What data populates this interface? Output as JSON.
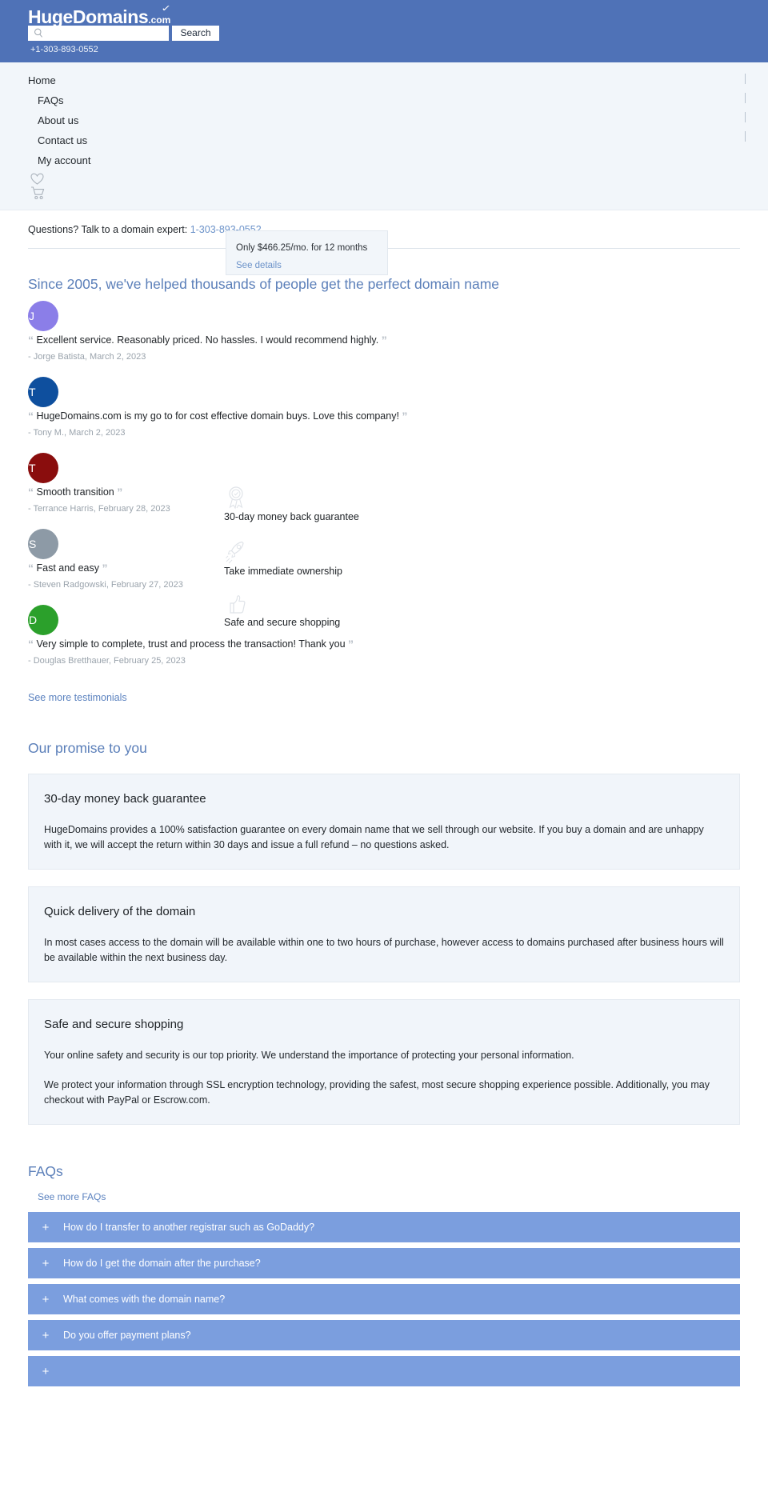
{
  "header": {
    "logo_main": "HugeDomains",
    "logo_suffix": ".com",
    "search_placeholder": "",
    "search_value": "",
    "search_button": "Search",
    "phone": "+1-303-893-0552",
    "brand_color": "#4f72b7"
  },
  "nav": {
    "items": [
      {
        "label": "Home",
        "sub": false
      },
      {
        "label": "FAQs",
        "sub": true
      },
      {
        "label": "About us",
        "sub": true
      },
      {
        "label": "Contact us",
        "sub": true
      },
      {
        "label": "My account",
        "sub": true
      }
    ],
    "icons": [
      {
        "name": "heart-icon"
      },
      {
        "name": "cart-icon"
      }
    ]
  },
  "expert": {
    "prefix": "Questions? Talk to a domain expert:",
    "phone": "1-303-893-0552"
  },
  "price_box": {
    "text": "Only $466.25/mo. for 12 months",
    "link": "See details"
  },
  "testimonials_section": {
    "title": "Since 2005, we've helped thousands of people get the perfect domain name",
    "see_more": "See more testimonials",
    "items": [
      {
        "initial": "J",
        "color": "#8b7ee8",
        "quote": "Excellent service. Reasonably priced. No hassles. I would recommend highly.",
        "author": "- Jorge Batista, March 2, 2023"
      },
      {
        "initial": "T",
        "color": "#0e4f9e",
        "quote": "HugeDomains.com is my go to for cost effective domain buys. Love this company!",
        "author": "- Tony M., March 2, 2023"
      },
      {
        "initial": "T",
        "color": "#8a0d0d",
        "quote": "Smooth transition",
        "author": "- Terrance Harris, February 28, 2023"
      },
      {
        "initial": "S",
        "color": "#8d9aa6",
        "quote": "Fast and easy",
        "author": "- Steven Radgowski, February 27, 2023"
      },
      {
        "initial": "D",
        "color": "#2ba02b",
        "quote": "Very simple to complete, trust and process the transaction! Thank you",
        "author": "- Douglas Bretthauer, February 25, 2023"
      }
    ],
    "quote_open": "“",
    "quote_close": "”"
  },
  "features": [
    {
      "icon": "badge-ribbon-icon",
      "label": "30-day money back guarantee"
    },
    {
      "icon": "rocket-icon",
      "label": "Take immediate ownership"
    },
    {
      "icon": "thumbs-up-icon",
      "label": "Safe and secure shopping"
    }
  ],
  "promise": {
    "title": "Our promise to you",
    "cards": [
      {
        "heading": "30-day money back guarantee",
        "paragraphs": [
          "HugeDomains provides a 100% satisfaction guarantee on every domain name that we sell through our website. If you buy a domain and are unhappy with it, we will accept the return within 30 days and issue a full refund – no questions asked."
        ]
      },
      {
        "heading": "Quick delivery of the domain",
        "paragraphs": [
          "In most cases access to the domain will be available within one to two hours of purchase, however access to domains purchased after business hours will be available within the next business day."
        ]
      },
      {
        "heading": "Safe and secure shopping",
        "paragraphs": [
          "Your online safety and security is our top priority. We understand the importance of protecting your personal information.",
          "We protect your information through SSL encryption technology, providing the safest, most secure shopping experience possible. Additionally, you may checkout with PayPal or Escrow.com."
        ]
      }
    ]
  },
  "faq": {
    "title": "FAQs",
    "see_more": "See more FAQs",
    "plus_icon": "+",
    "items": [
      {
        "question": "How do I transfer to another registrar such as GoDaddy?"
      },
      {
        "question": "How do I get the domain after the purchase?"
      },
      {
        "question": "What comes with the domain name?"
      },
      {
        "question": "Do you offer payment plans?"
      },
      {
        "question": ""
      }
    ]
  }
}
